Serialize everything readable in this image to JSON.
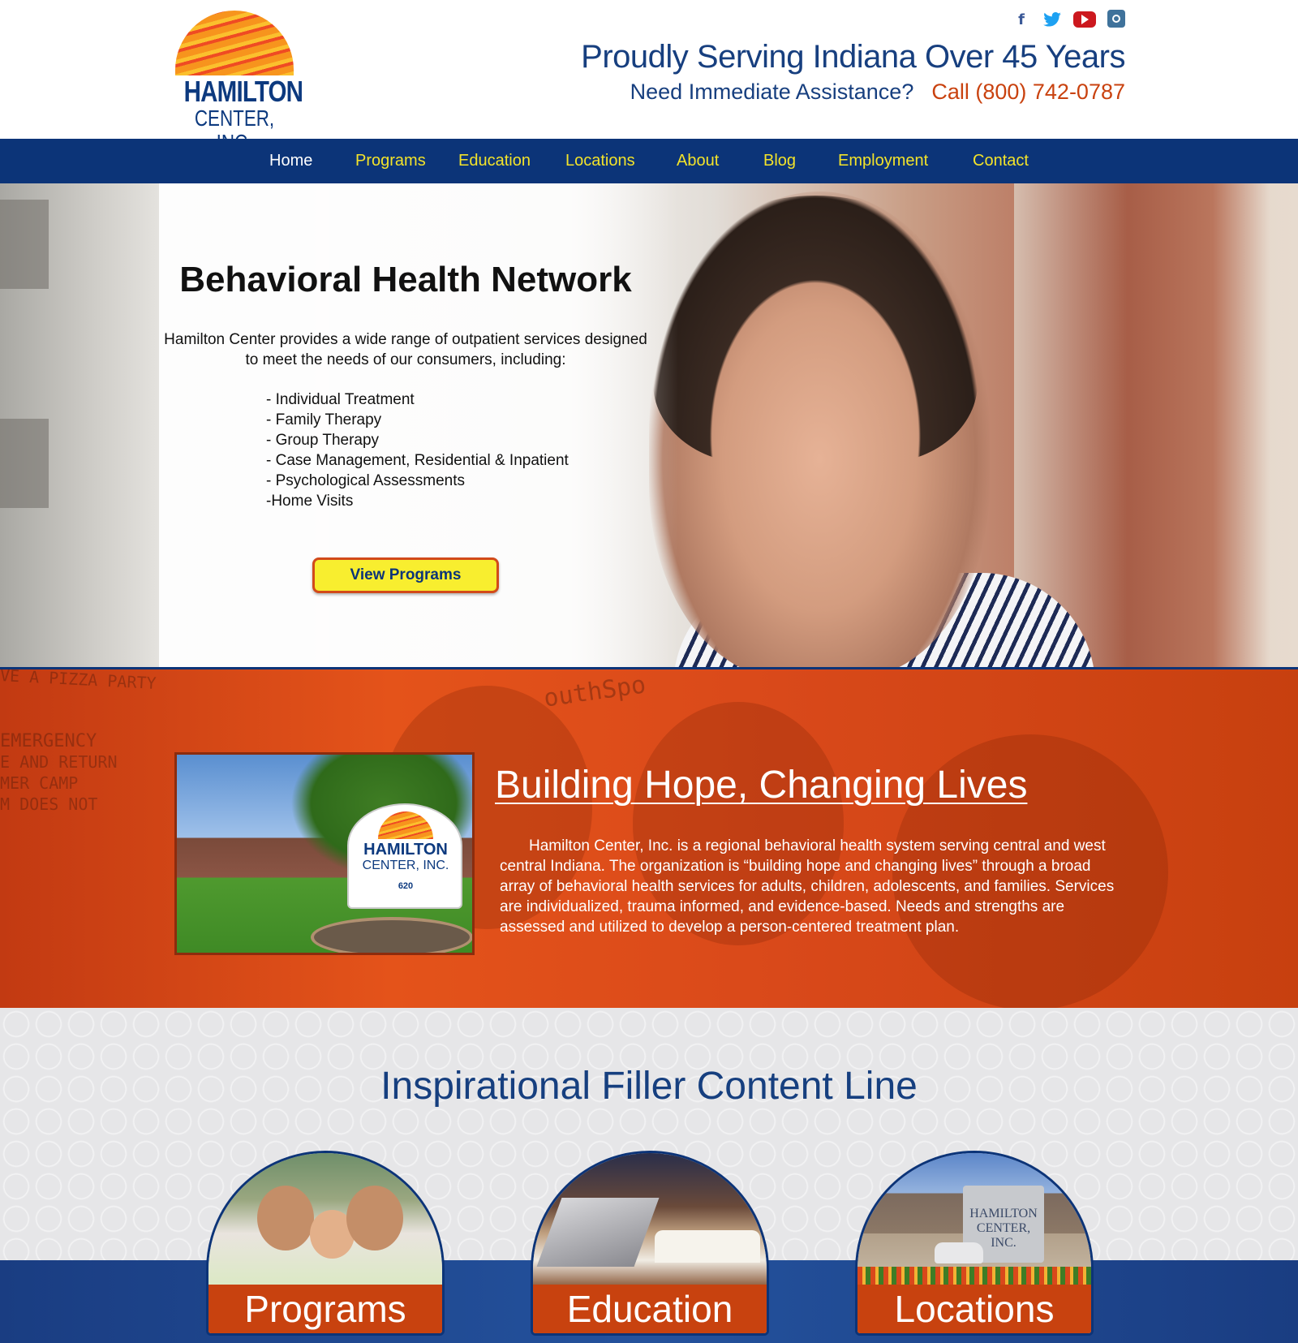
{
  "header": {
    "logo_line1": "HAMILTON",
    "logo_line2": "CENTER, INC.",
    "social": [
      "facebook-icon",
      "twitter-icon",
      "youtube-icon",
      "instagram-icon"
    ],
    "tagline": "Proudly Serving Indiana Over 45 Years",
    "assist_question": "Need Immediate Assistance?",
    "assist_call": "Call (800) 742-0787"
  },
  "nav": {
    "items": [
      {
        "label": "Home",
        "active": true
      },
      {
        "label": "Programs"
      },
      {
        "label": "Education"
      },
      {
        "label": "Locations"
      },
      {
        "label": "About"
      },
      {
        "label": "Blog"
      },
      {
        "label": "Employment"
      },
      {
        "label": "Contact"
      }
    ]
  },
  "hero": {
    "title": "Behavioral Health Network",
    "description": "Hamilton Center provides a wide range of outpatient services designed to meet the needs of our consumers, including:",
    "services": [
      "- Individual Treatment",
      "- Family Therapy",
      "- Group Therapy",
      "- Case Management, Residential & Inpatient",
      "- Psychological Assessments",
      "-Home Visits"
    ],
    "button": "View Programs"
  },
  "band": {
    "background_text": [
      "VE A PIZZA PARTY",
      "EMERGENCY",
      "E AND RETURN",
      "MER CAMP",
      "M DOES NOT",
      "outhSpo"
    ],
    "photo_sign": {
      "line1": "HAMILTON",
      "line2": "CENTER, INC.",
      "number": "620"
    },
    "title": "Building Hope, Changing Lives",
    "text": "Hamilton Center, Inc. is a regional behavioral health system serving central and west central Indiana. The organization is “building hope and changing lives” through a broad array of behavioral health services for adults, children, adolescents, and families. Services are individualized, trauma informed, and evidence-based. Needs and strengths are assessed and utilized to develop a person-centered treatment plan."
  },
  "feature": {
    "title": "Inspirational Filler Content Line",
    "cards": [
      {
        "label": "Programs"
      },
      {
        "label": "Education"
      },
      {
        "label": "Locations",
        "sign_text": "HAMILTON CENTER, INC."
      }
    ]
  },
  "colors": {
    "navy": "#0c3478",
    "nav_link": "#f3e32a",
    "accent_orange": "#c8420f",
    "call_red": "#c9420f",
    "button_yellow": "#f8ee2f"
  }
}
